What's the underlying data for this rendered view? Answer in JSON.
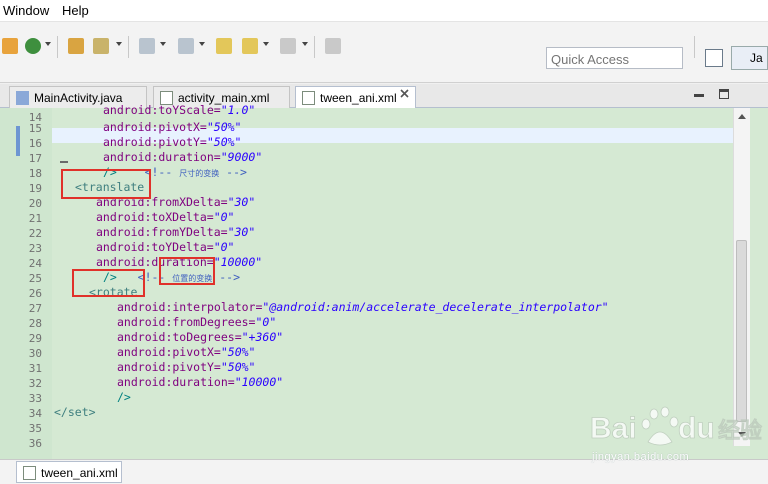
{
  "menubar": {
    "items": [
      "Window",
      "Help"
    ]
  },
  "toolbar": {
    "quick_access_placeholder": "Quick Access",
    "perspective_label": "Ja"
  },
  "tabs": [
    {
      "label": "MainActivity.java",
      "active": false
    },
    {
      "label": "activity_main.xml",
      "active": false
    },
    {
      "label": "tween_ani.xml",
      "active": true
    }
  ],
  "editor": {
    "line_numbers": [
      "14",
      "15",
      "16",
      "17",
      "18",
      "19",
      "20",
      "21",
      "22",
      "23",
      "24",
      "25",
      "26",
      "27",
      "28",
      "29",
      "30",
      "31",
      "32",
      "33",
      "34",
      "35",
      "36"
    ],
    "lines": {
      "l14": {
        "attr": "android:toYScale=",
        "val": "\"1.0\""
      },
      "l15": {
        "attr": "android:pivotX=",
        "val": "\"50%\""
      },
      "l16": {
        "attr": "android:pivotY=",
        "val": "\"50%\""
      },
      "l17": {
        "attr": "android:duration=",
        "val": "\"9000\""
      },
      "l18": {
        "close": "/>",
        "comment_open": "<!--",
        "comment_text": "尺寸的变换",
        "comment_close": "-->"
      },
      "l19": {
        "tag": "<translate"
      },
      "l20": {
        "attr": "android:fromXDelta=",
        "val": "\"30\""
      },
      "l21": {
        "attr": "android:toXDelta=",
        "val": "\"0\""
      },
      "l22": {
        "attr": "android:fromYDelta=",
        "val": "\"30\""
      },
      "l23": {
        "attr": "android:toYDelta=",
        "val": "\"0\""
      },
      "l24": {
        "attr": "android:duration=",
        "val": "\"10000\""
      },
      "l25": {
        "close": "/>",
        "comment_open": "<!--",
        "comment_text": "位置的变换",
        "comment_close": "-->"
      },
      "l26": {
        "tag": "<rotate"
      },
      "l27": {
        "attr": "android:interpolator=",
        "val": "\"@android:anim/accelerate_decelerate_interpolator\""
      },
      "l28": {
        "attr": "android:fromDegrees=",
        "val": "\"0\""
      },
      "l29": {
        "attr": "android:toDegrees=",
        "val": "\"+360\""
      },
      "l30": {
        "attr": "android:pivotX=",
        "val": "\"50%\""
      },
      "l31": {
        "attr": "android:pivotY=",
        "val": "\"50%\""
      },
      "l32": {
        "attr": "android:duration=",
        "val": "\"10000\""
      },
      "l33": {
        "close": "/>"
      },
      "l34": {
        "tag": "</set>"
      }
    }
  },
  "bottom_tab": {
    "label": "tween_ani.xml"
  },
  "watermark": {
    "logo": "Baidu 经验",
    "url": "jingyan.baidu.com"
  },
  "colors": {
    "editor_bg": "#d5e9d3",
    "current_line": "#e8f2fe",
    "highlight_box": "#e0312a",
    "xml_tag": "#3f7f7f",
    "xml_attr": "#7f007f",
    "xml_value": "#2a00ff",
    "xml_comment": "#3f5fbf"
  }
}
